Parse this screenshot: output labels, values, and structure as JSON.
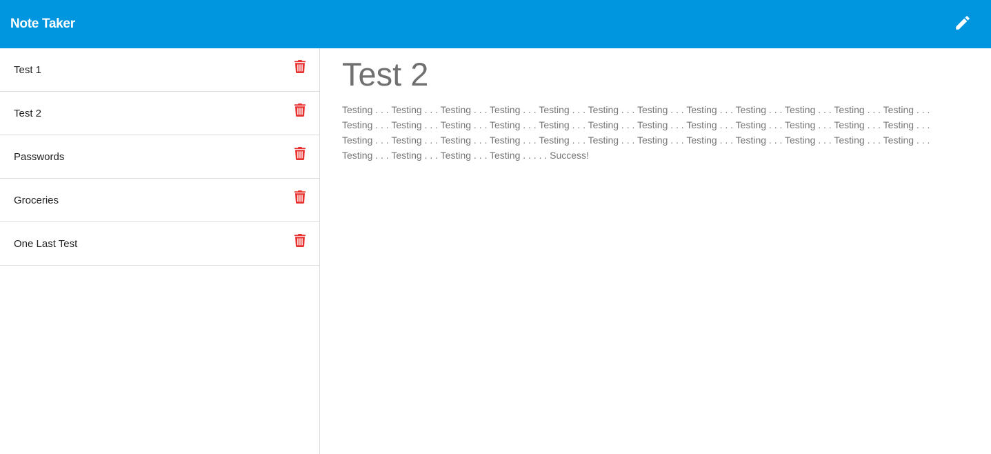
{
  "app": {
    "title": "Note Taker",
    "icons": {
      "new_note": "pencil-icon",
      "delete": "trash-icon"
    },
    "colors": {
      "navbar": "#0096df",
      "delete_icon": "#e8312f"
    }
  },
  "sidebar": {
    "notes": [
      {
        "title": "Test 1"
      },
      {
        "title": "Test 2"
      },
      {
        "title": "Passwords"
      },
      {
        "title": "Groceries"
      },
      {
        "title": "One Last Test"
      }
    ]
  },
  "main": {
    "note_title": "Test 2",
    "note_text": "Testing . . . Testing . . . Testing . . . Testing . . . Testing . . . Testing . . . Testing . . . Testing . . . Testing . . . Testing . . . Testing . . . Testing . . . Testing . . . Testing . . . Testing . . . Testing . . . Testing . . . Testing . . . Testing . . . Testing . . . Testing . . . Testing . . . Testing . . . Testing . . . Testing . . . Testing . . . Testing . . . Testing . . . Testing . . . Testing . . . Testing . . . Testing . . . Testing . . . Testing . . . Testing . . . Testing . . . Testing . . . Testing . . . Testing . . . Testing . . . . . Success!"
  }
}
